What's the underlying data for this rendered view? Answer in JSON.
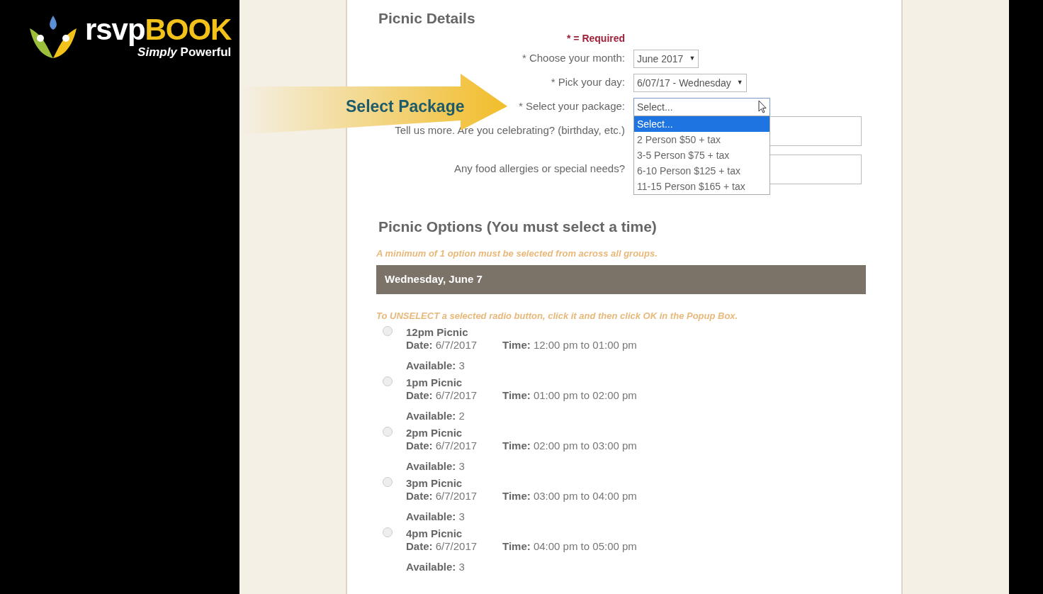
{
  "logo": {
    "lead": "rsvp",
    "accent": "BOOK",
    "tagline": "*Simply* Powerful"
  },
  "callout": {
    "text": "Select Package"
  },
  "details": {
    "title": "Picnic Details",
    "required_note": "* = Required",
    "fields": [
      {
        "kind": "select",
        "label": "* Choose your month:",
        "value": "June 2017",
        "arrow": "▼"
      },
      {
        "kind": "select",
        "label": "* Pick your day:",
        "value": "6/07/17 - Wednesday",
        "arrow": "▼"
      },
      {
        "kind": "open-select",
        "label": "* Select your package:",
        "value": "Select...",
        "options": [
          {
            "label": "Select...",
            "selected": true
          },
          {
            "label": "2 Person $50 + tax",
            "selected": false
          },
          {
            "label": "3-5 Person $75 + tax",
            "selected": false
          },
          {
            "label": "6-10 Person $125 + tax",
            "selected": false
          },
          {
            "label": "11-15 Person $165 + tax",
            "selected": false
          }
        ]
      },
      {
        "kind": "textarea",
        "label": "Tell us more. Are you celebrating? (birthday, etc.)"
      },
      {
        "kind": "textarea",
        "label": "Any food allergies or special needs?"
      }
    ]
  },
  "options": {
    "title": "Picnic Options (You must select a time)",
    "note": "A minimum of 1 option must be selected from across all groups.",
    "day_header": "Wednesday, June 7",
    "hint": "To UNSELECT a selected radio button, click it and then click OK in the Popup Box.",
    "slots": [
      {
        "name": "12pm Picnic",
        "date_label": "Date:",
        "date": "6/7/2017",
        "time_label": "Time:",
        "time": "12:00 pm to 01:00 pm",
        "available_label": "Available:",
        "available": "3",
        "selected": false
      },
      {
        "name": "1pm Picnic",
        "date_label": "Date:",
        "date": "6/7/2017",
        "time_label": "Time:",
        "time": "01:00 pm to 02:00 pm",
        "available_label": "Available:",
        "available": "2",
        "selected": false
      },
      {
        "name": "2pm Picnic",
        "date_label": "Date:",
        "date": "6/7/2017",
        "time_label": "Time:",
        "time": "02:00 pm to 03:00 pm",
        "available_label": "Available:",
        "available": "3",
        "selected": false
      },
      {
        "name": "3pm Picnic",
        "date_label": "Date:",
        "date": "6/7/2017",
        "time_label": "Time:",
        "time": "03:00 pm to 04:00 pm",
        "available_label": "Available:",
        "available": "3",
        "selected": false
      },
      {
        "name": "4pm Picnic",
        "date_label": "Date:",
        "date": "6/7/2017",
        "time_label": "Time:",
        "time": "04:00 pm to 05:00 pm",
        "available_label": "Available:",
        "available": "3",
        "selected": false
      }
    ]
  }
}
